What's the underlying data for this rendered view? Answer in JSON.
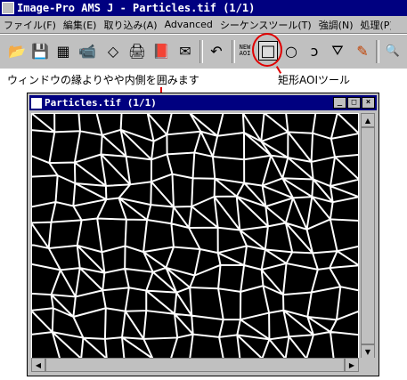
{
  "app": {
    "title": "Image-Pro AMS J - Particles.tif (1/1)"
  },
  "menu": [
    "ファイル(F)",
    "編集(E)",
    "取り込み(A)",
    "Advanced",
    "シーケンスツール(T)",
    "強調(N)",
    "処理(P)"
  ],
  "toolbar": {
    "buttons": [
      {
        "name": "open-icon",
        "glyph": "📂"
      },
      {
        "name": "save-icon",
        "glyph": "💾"
      },
      {
        "name": "grid-icon",
        "glyph": "▦"
      },
      {
        "name": "camera-icon",
        "glyph": "📹"
      },
      {
        "name": "eraser-icon",
        "glyph": "◇"
      },
      {
        "name": "print-icon",
        "glyph": "🖨"
      },
      {
        "name": "book-icon",
        "glyph": "📕"
      },
      {
        "name": "mail-icon",
        "glyph": "✉"
      },
      {
        "name": "undo-icon",
        "glyph": "↶"
      }
    ],
    "new_aoi_line1": "NEW",
    "new_aoi_line2": "AOI",
    "tools": [
      {
        "name": "rectangle-aoi-icon",
        "glyph": "□"
      },
      {
        "name": "ellipse-aoi-icon",
        "glyph": "○"
      },
      {
        "name": "irregular-aoi-icon",
        "glyph": "ↄ"
      },
      {
        "name": "bucket-icon",
        "glyph": "⛛"
      },
      {
        "name": "pencil-icon",
        "glyph": "✎"
      },
      {
        "name": "magnifier-icon",
        "glyph": "🔍"
      }
    ]
  },
  "annotations": {
    "left": "ウィンドウの縁よりやや内側を囲みます",
    "right": "矩形AOIツール"
  },
  "window": {
    "title": "Particles.tif (1/1)",
    "min": "_",
    "max": "□",
    "close": "×"
  }
}
